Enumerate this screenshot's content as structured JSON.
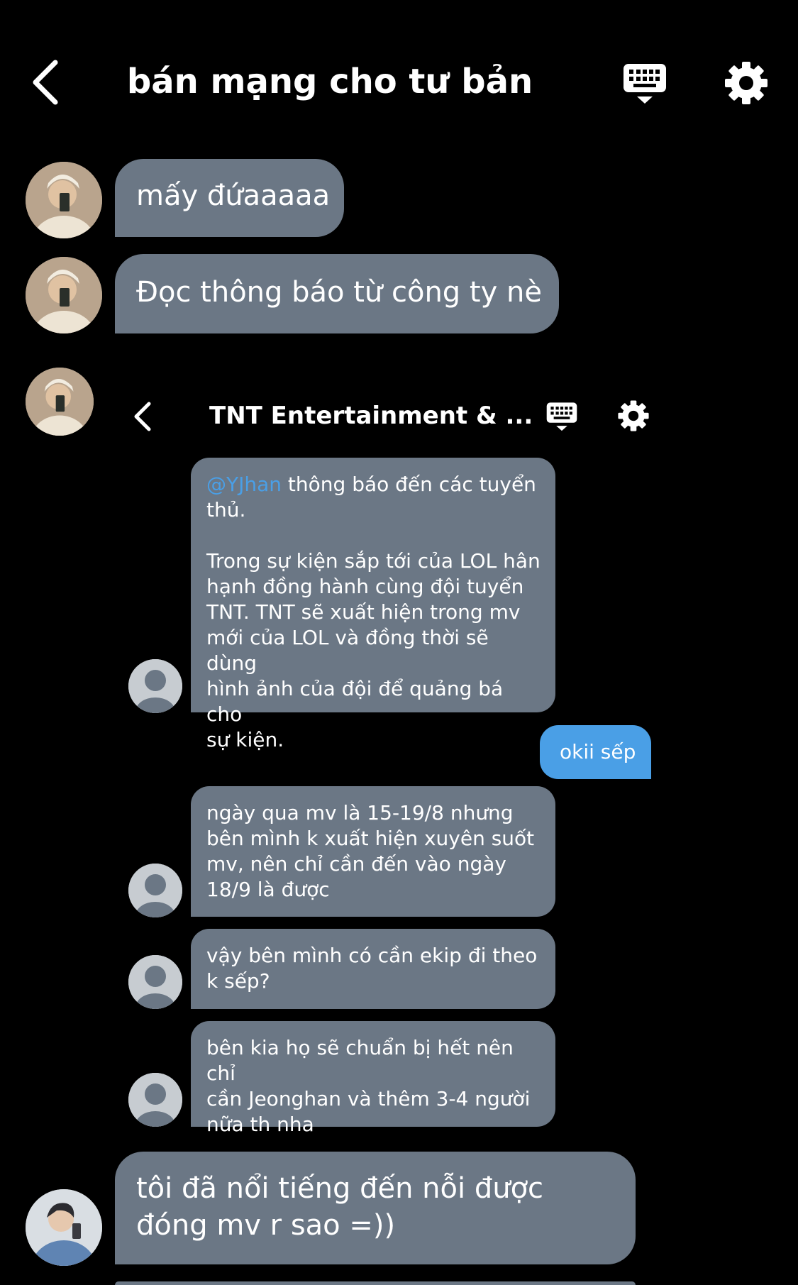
{
  "header": {
    "title": "bán mạng cho tư bản",
    "icons": {
      "back": "chevron-left-icon",
      "keyboard": "keyboard-icon",
      "settings": "gear-icon"
    }
  },
  "messages": [
    {
      "sender": "member-1",
      "text": "mấy đứaaaaa"
    },
    {
      "sender": "member-1",
      "text": "Đọc thông báo từ công ty nè"
    },
    {
      "sender": "member-2",
      "lines": [
        "tôi đã nổi tiếng đến nỗi được",
        "đóng mv r sao =))"
      ]
    }
  ],
  "screenshot": {
    "title": "TNT Entertainment & ...",
    "messages": [
      {
        "mention": "@YJhan",
        "first_text": " thông báo đến các tuyển",
        "lines": [
          "thủ.",
          "",
          "Trong sự kiện sắp tới của LOL hân",
          "hạnh đồng hành cùng đội tuyển",
          "TNT. TNT sẽ xuất hiện trong mv",
          "mới của LOL và đồng thời sẽ dùng",
          "hình ảnh của đội để quảng bá cho",
          "sự kiện."
        ]
      },
      {
        "reply": "okii sếp"
      },
      {
        "lines": [
          "ngày qua mv là 15-19/8 nhưng",
          "bên mình k xuất hiện xuyên suốt",
          "mv, nên chỉ cần đến vào ngày",
          "18/9 là được"
        ]
      },
      {
        "lines": [
          "vậy bên mình có cần ekip đi theo",
          "k sếp?"
        ]
      },
      {
        "lines": [
          "bên kia họ sẽ chuẩn bị hết nên chỉ",
          "cần Jeonghan và thêm 3-4 người",
          "nữa th nha"
        ]
      }
    ]
  },
  "colors": {
    "background": "#000000",
    "bubble": "#6b7785",
    "accent": "#4a9fe6"
  }
}
